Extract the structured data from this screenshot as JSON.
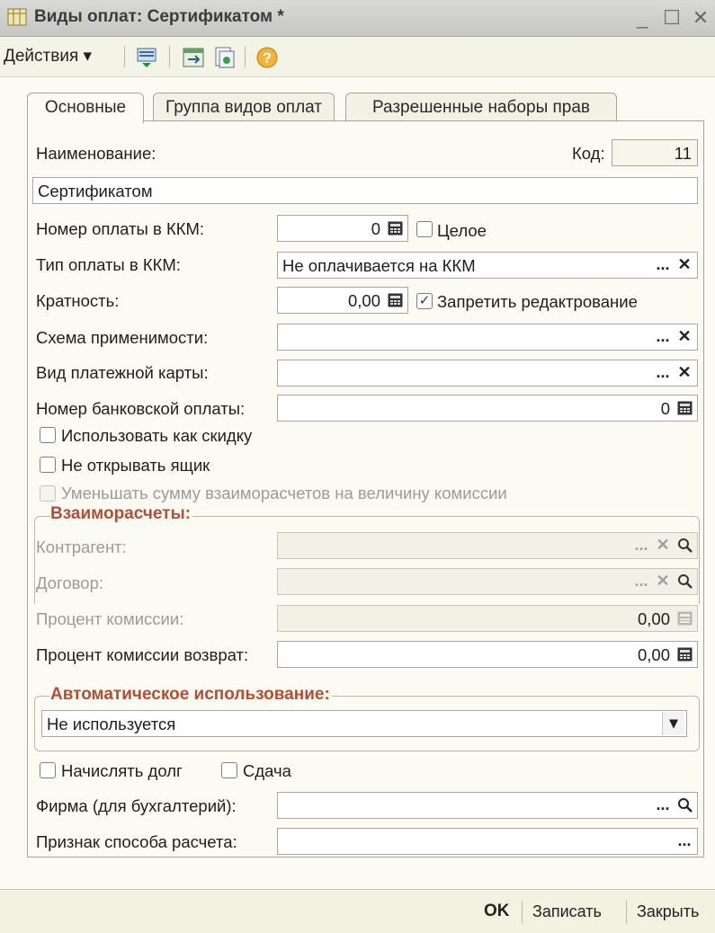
{
  "window": {
    "title": "Виды оплат: Сертификатом *",
    "minimize_glyph": "_",
    "maximize_glyph": "☐",
    "close_glyph": "✕"
  },
  "toolbar": {
    "actions_label": "Действия ▾",
    "icons": [
      "structure-icon",
      "move-icon",
      "copy-icon",
      "help-icon"
    ]
  },
  "tabs": [
    {
      "label": "Основные",
      "active": true
    },
    {
      "label": "Группа видов оплат",
      "active": false
    },
    {
      "label": "Разрешенные наборы прав",
      "active": false
    }
  ],
  "form": {
    "name_label": "Наименование:",
    "code_label": "Код:",
    "code_value": "11",
    "name_value": "Сертификатом",
    "kkm_number_label": "Номер оплаты в ККМ:",
    "kkm_number_value": "0",
    "whole_label": "Целое",
    "whole_checked": false,
    "kkm_type_label": "Тип оплаты в ККМ:",
    "kkm_type_value": "Не оплачивается на ККМ",
    "multiplicity_label": "Кратность:",
    "multiplicity_value": "0,00",
    "forbid_edit_label": "Запретить редактрование",
    "forbid_edit_checked": true,
    "scheme_label": "Схема применимости:",
    "scheme_value": "",
    "card_type_label": "Вид платежной карты:",
    "card_type_value": "",
    "bank_number_label": "Номер банковской оплаты:",
    "bank_number_value": "0",
    "use_discount_label": "Использовать как скидку",
    "no_drawer_label": "Не открывать ящик",
    "reduce_label": "Уменьшать сумму взаиморасчетов на величину комиссии",
    "settlements_title": "Взаиморасчеты:",
    "counterparty_label": "Контрагент:",
    "counterparty_value": "",
    "contract_label": "Договор:",
    "contract_value": "",
    "commission_label": "Процент комиссии:",
    "commission_value": "0,00",
    "commission_return_label": "Процент комиссии возврат:",
    "commission_return_value": "0,00",
    "auto_title": "Автоматическое использование:",
    "auto_value": "Не используется",
    "accrue_debt_label": "Начислять долг",
    "change_label": "Сдача",
    "firm_label": "Фирма (для бухгалтерий):",
    "firm_value": "",
    "calc_sign_label": "Признак способа расчета:",
    "calc_sign_value": "",
    "btn_ellipsis": "...",
    "btn_clear": "✕",
    "btn_search": "🔍",
    "dropdown_glyph": "▾"
  },
  "footer": {
    "ok_label": "OK",
    "save_label": "Записать",
    "close_label": "Закрыть"
  }
}
